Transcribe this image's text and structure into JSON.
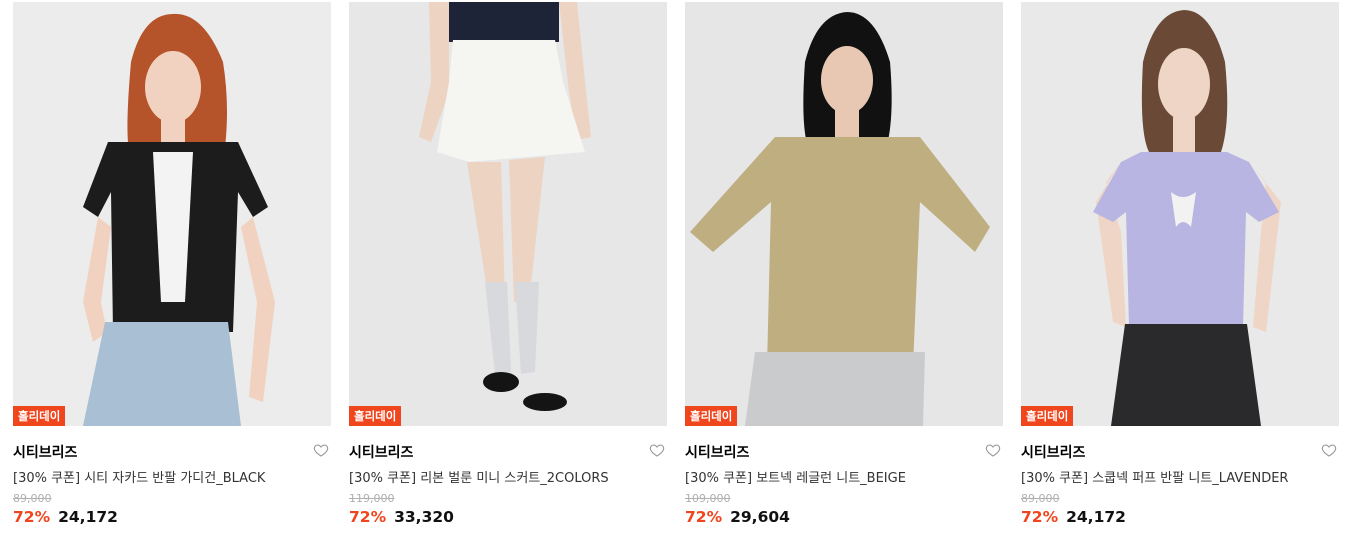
{
  "products": [
    {
      "badge": "홀리데이",
      "brand": "시티브리즈",
      "name": "[30% 쿠폰] 시티 자카드 반팔 가디건_BLACK",
      "original_price": "89,000",
      "discount": "72%",
      "price": "24,172",
      "colors": {
        "bg": "#ececec",
        "top": "#1c1c1c",
        "bottom": "#a9bfd3",
        "hair": "#b5532a",
        "skin": "#f1d2c0"
      }
    },
    {
      "badge": "홀리데이",
      "brand": "시티브리즈",
      "name": "[30% 쿠폰] 리본 벌룬 미니 스커트_2COLORS",
      "original_price": "119,000",
      "discount": "72%",
      "price": "33,320",
      "colors": {
        "bg": "#e7e7e7",
        "top": "#1d2438",
        "bottom": "#f5f5f2",
        "hair": "#000000",
        "skin": "#ecd3c2"
      }
    },
    {
      "badge": "홀리데이",
      "brand": "시티브리즈",
      "name": "[30% 쿠폰] 보트넥 레글런 니트_BEIGE",
      "original_price": "109,000",
      "discount": "72%",
      "price": "29,604",
      "colors": {
        "bg": "#e6e6e6",
        "top": "#bfae80",
        "bottom": "#c9cbcc",
        "hair": "#111111",
        "skin": "#e8c8b3"
      }
    },
    {
      "badge": "홀리데이",
      "brand": "시티브리즈",
      "name": "[30% 쿠폰] 스쿱넥 퍼프 반팔 니트_LAVENDER",
      "original_price": "89,000",
      "discount": "72%",
      "price": "24,172",
      "colors": {
        "bg": "#e9e9e9",
        "top": "#b9b5e2",
        "bottom": "#2a2a2c",
        "hair": "#6a4a36",
        "skin": "#eed5c6"
      }
    }
  ]
}
